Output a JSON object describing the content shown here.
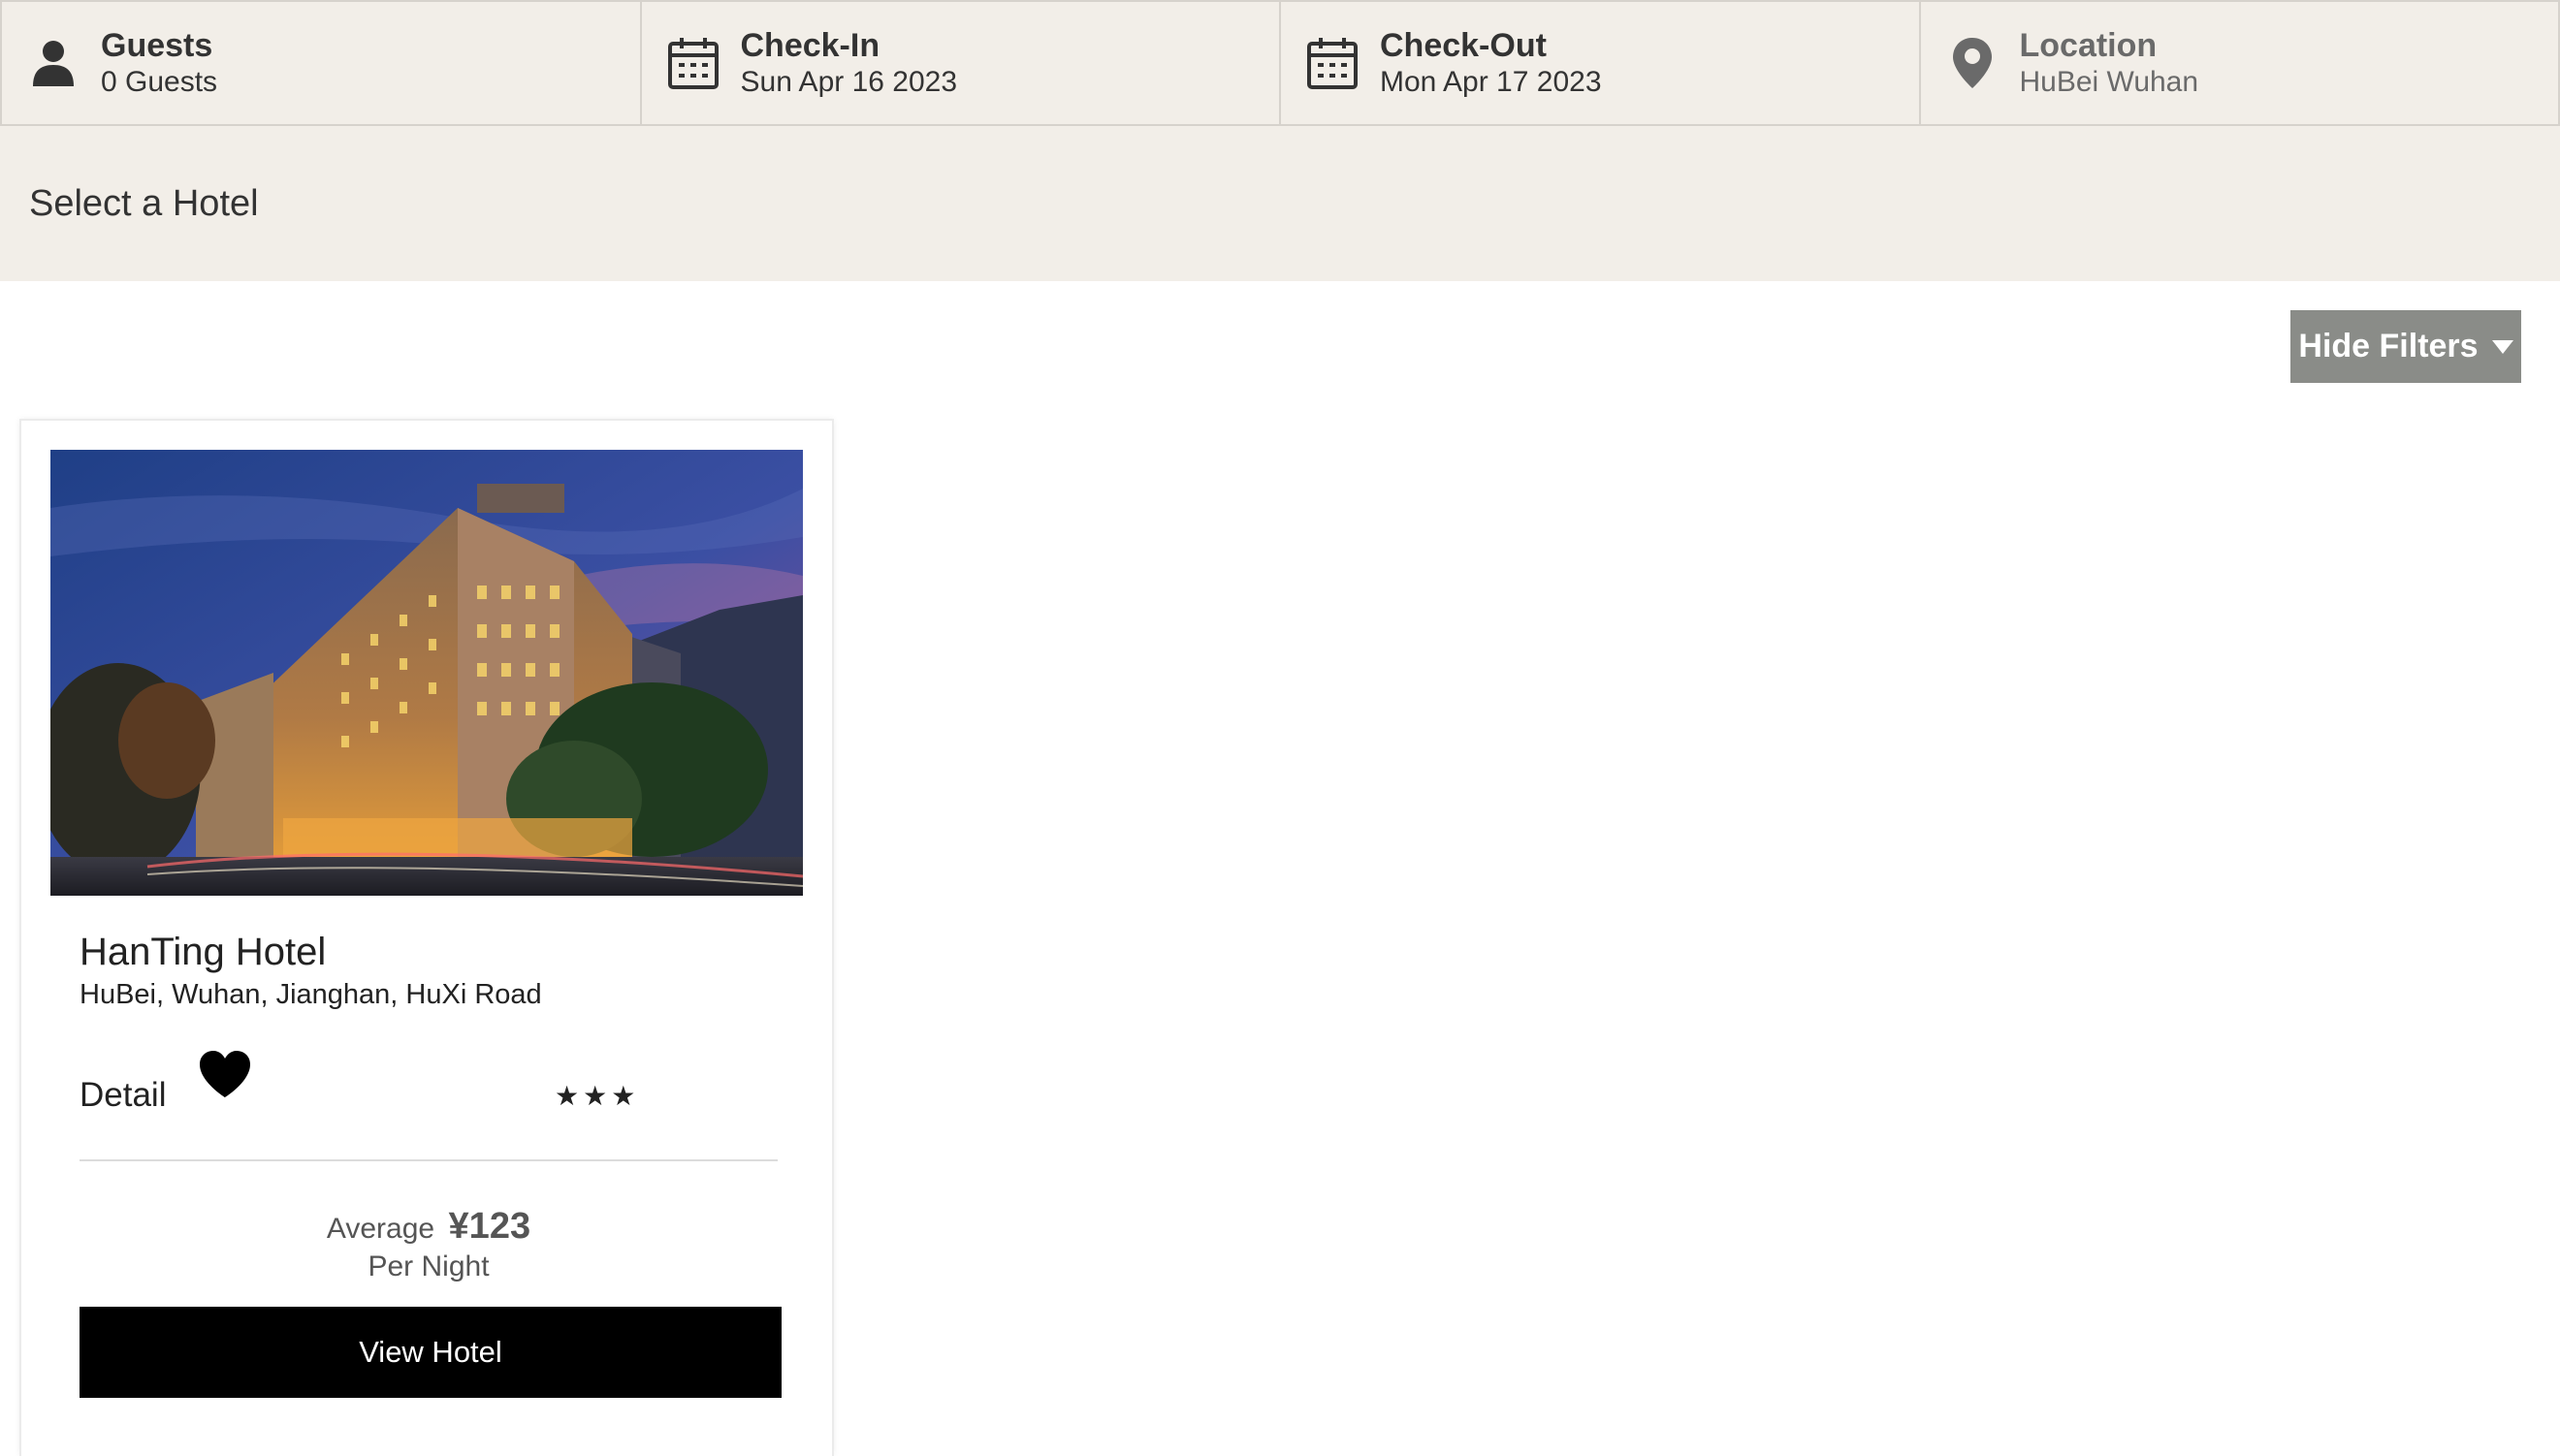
{
  "search": {
    "guests": {
      "title": "Guests",
      "value": "0 Guests",
      "icon": "person-icon"
    },
    "check_in": {
      "title": "Check-In",
      "value": "Sun Apr 16 2023",
      "icon": "calendar-icon"
    },
    "check_out": {
      "title": "Check-Out",
      "value": "Mon Apr 17 2023",
      "icon": "calendar-icon"
    },
    "location": {
      "title": "Location",
      "value": "HuBei Wuhan",
      "icon": "map-pin-icon"
    }
  },
  "page": {
    "heading": "Select a Hotel"
  },
  "filters": {
    "toggle_label": "Hide Filters",
    "icon": "caret-down-icon"
  },
  "hotels": [
    {
      "name": "HanTing Hotel",
      "address": "HuBei, Wuhan, Jianghan, HuXi Road",
      "detail_label": "Detail",
      "stars_text": "★★★",
      "star_rating": 3,
      "favorite_icon": "heart-icon",
      "price_prefix": "Average",
      "price": "¥123",
      "price_suffix": "Per Night",
      "button_label": "View Hotel"
    }
  ],
  "colors": {
    "header_bg": "#f2eee8",
    "header_border": "#d6d2cc",
    "filter_button_bg": "#8a8c88",
    "primary_button_bg": "#000000"
  }
}
